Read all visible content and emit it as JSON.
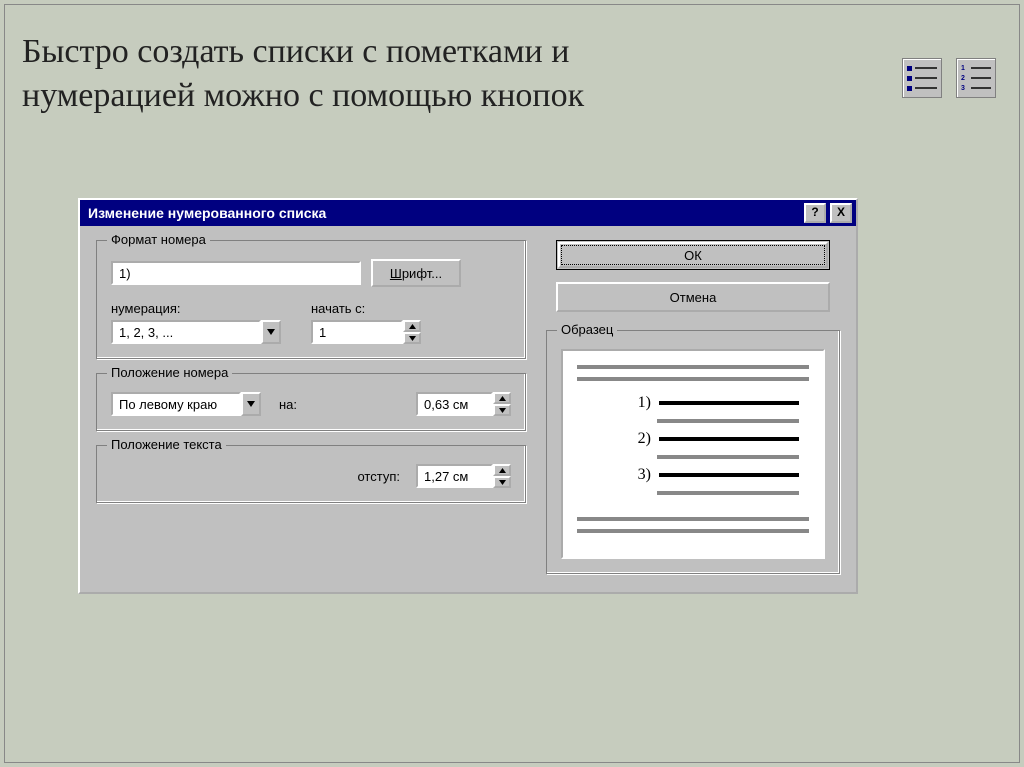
{
  "heading_line1": "Быстро создать списки с пометками и",
  "heading_line2": "нумерацией можно с помощью кнопок",
  "dialog": {
    "title": "Изменение нумерованного списка",
    "help_btn": "?",
    "close_btn": "X",
    "group_format": {
      "legend": "Формат номера",
      "value": "1)",
      "font_btn": "Шрифт...",
      "numbering_label": "нумерация:",
      "numbering_value": "1, 2, 3, ...",
      "start_label": "начать с:",
      "start_value": "1"
    },
    "group_numpos": {
      "legend": "Положение номера",
      "align_value": "По левому краю",
      "at_label": "на:",
      "at_value": "0,63 см"
    },
    "group_textpos": {
      "legend": "Положение текста",
      "indent_label": "отступ:",
      "indent_value": "1,27 см"
    },
    "preview_legend": "Образец",
    "preview_numbers": [
      "1)",
      "2)",
      "3)"
    ],
    "ok_btn": "ОК",
    "cancel_btn": "Отмена"
  }
}
